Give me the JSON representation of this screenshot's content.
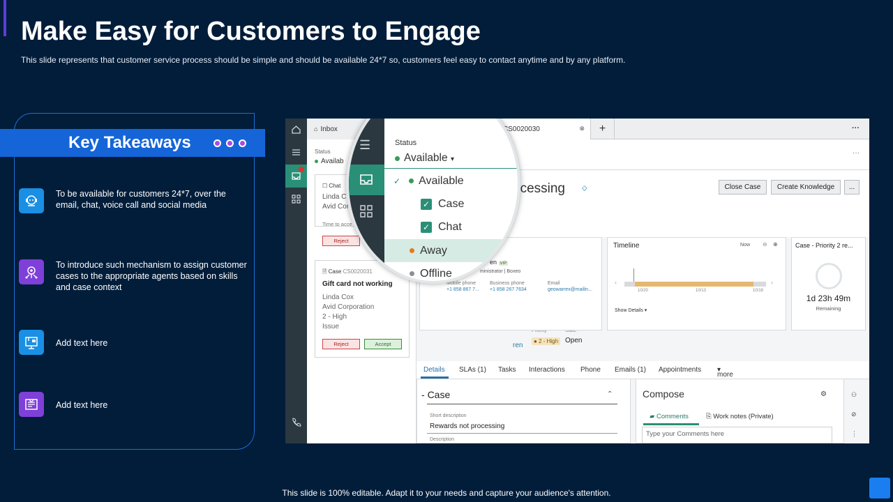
{
  "header": {
    "title": "Make Easy for Customers to Engage",
    "subtitle": "This slide represents that customer service process should be simple and should be available 24*7 so, customers feel easy to contact anytime and by any platform."
  },
  "takeaways": {
    "title": "Key Takeaways",
    "items": [
      {
        "icon": "support-agent-icon",
        "text": "To be available for customers 24*7, over the email, chat, voice call and social media"
      },
      {
        "icon": "network-settings-icon",
        "text": "To introduce such mechanism to assign customer cases to the appropriate agents based on skills and case context"
      },
      {
        "icon": "presentation-board-icon",
        "text": "Add text here"
      },
      {
        "icon": "document-list-icon",
        "text": "Add text here"
      }
    ]
  },
  "screenshot": {
    "tabs": {
      "inbox": "Inbox",
      "case": "CS0020030"
    },
    "inbox": {
      "status_label": "Status",
      "status_value": "Availab",
      "chat_card": {
        "type": "Chat",
        "name": "Linda C",
        "company": "Avid Cor",
        "time": "Time to acce",
        "reject": "Reject"
      },
      "case_card": {
        "type": "Case",
        "number": "CS0020031",
        "title": "Gift card not working",
        "name": "Linda Cox",
        "company": "Avid Corporation",
        "priority": "2 - High",
        "category": "Issue",
        "reject": "Reject",
        "accept": "Accept"
      }
    },
    "case": {
      "title": "ocessing",
      "close_button": "Close Case",
      "knowledge_button": "Create Knowledge",
      "more": "...",
      "priority_label": "Priority",
      "priority_value": "2 - High",
      "state_label": "State",
      "state_value": "Open",
      "assigned_partial": "ren",
      "contact": {
        "name_partial": "en",
        "vip": "VIP",
        "role": "ministrator | Boxeo",
        "mobile_label": "Mobile phone",
        "mobile_value": "+1 858 867 7...",
        "business_label": "Business phone",
        "business_value": "+1 858 267 7634",
        "email_label": "Email",
        "email_value": "geowarrex@mailin..."
      },
      "timeline": {
        "title": "Timeline",
        "now": "Now",
        "ticks": [
          "10/20",
          "10/13",
          "10/18"
        ],
        "details": "Show Details"
      },
      "sla": {
        "title": "Case - Priority 2 re...",
        "time": "1d 23h 49m",
        "remaining": "Remaining"
      },
      "tabs": [
        "Details",
        "SLAs (1)",
        "Tasks",
        "Interactions",
        "Phone",
        "Emails (1)",
        "Appointments",
        "more"
      ],
      "form": {
        "section": "Case",
        "short_desc_label": "Short description",
        "short_desc_value": "Rewards not processing",
        "desc_label": "Description"
      },
      "compose": {
        "title": "Compose",
        "comments": "Comments",
        "work_notes": "Work notes (Private)",
        "placeholder": "Type your Comments here"
      }
    },
    "status_menu": {
      "label": "Status",
      "current": "Available",
      "options": [
        {
          "label": "Available",
          "color": "#3a9a5a",
          "checked": true
        },
        {
          "label": "Case",
          "checkbox": true
        },
        {
          "label": "Chat",
          "checkbox": true
        },
        {
          "label": "Away",
          "color": "#e07b1f"
        },
        {
          "label": "Offline",
          "color": "#8a9096"
        }
      ]
    }
  },
  "footer": "This slide is 100% editable. Adapt it to your needs and capture your audience's attention."
}
